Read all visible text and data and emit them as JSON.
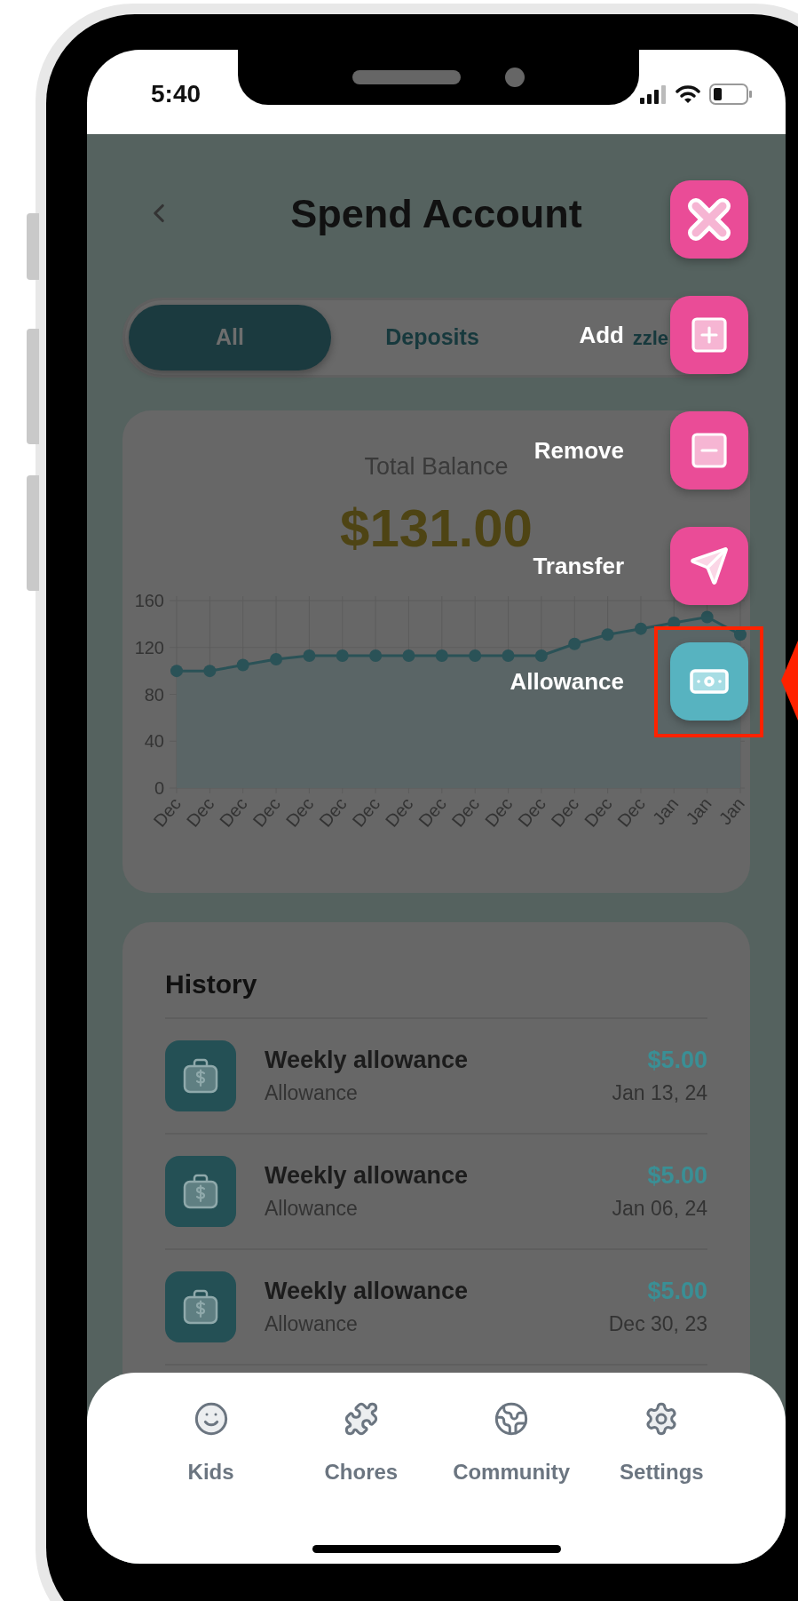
{
  "status_bar": {
    "time": "5:40"
  },
  "header": {
    "title": "Spend Account"
  },
  "tabs": [
    {
      "label": "All",
      "selected": true
    },
    {
      "label": "Deposits",
      "selected": false
    },
    {
      "label": "zzle",
      "selected": false
    }
  ],
  "balance": {
    "label": "Total Balance",
    "amount": "$131.00",
    "chart_data": {
      "type": "area",
      "categories": [
        "Dec",
        "Dec",
        "Dec",
        "Dec",
        "Dec",
        "Dec",
        "Dec",
        "Dec",
        "Dec",
        "Dec",
        "Dec",
        "Dec",
        "Dec",
        "Dec",
        "Dec",
        "Jan",
        "Jan",
        "Jan"
      ],
      "grid": true,
      "series": [
        {
          "color": "#2a5257",
          "values": [
            100,
            100,
            105,
            110,
            113,
            113,
            113,
            113,
            113,
            113,
            113,
            113,
            123,
            131,
            136,
            141,
            146,
            131
          ]
        }
      ],
      "ylim": [
        0,
        160
      ],
      "yticks": [
        0,
        40,
        80,
        120,
        160
      ]
    }
  },
  "history": {
    "title": "History",
    "items": [
      {
        "title": "Weekly allowance",
        "category": "Allowance",
        "amount": "$5.00",
        "date": "Jan 13, 24"
      },
      {
        "title": "Weekly allowance",
        "category": "Allowance",
        "amount": "$5.00",
        "date": "Jan 06, 24"
      },
      {
        "title": "Weekly allowance",
        "category": "Allowance",
        "amount": "$5.00",
        "date": "Dec 30, 23"
      }
    ]
  },
  "action_menu": [
    {
      "kind": "close",
      "highlighted": false
    },
    {
      "kind": "add",
      "label": "Add",
      "highlighted": false
    },
    {
      "kind": "remove",
      "label": "Remove",
      "highlighted": false
    },
    {
      "kind": "transfer",
      "label": "Transfer",
      "highlighted": false
    },
    {
      "kind": "allowance",
      "label": "Allowance",
      "highlighted": true
    }
  ],
  "nav": [
    {
      "kind": "kids",
      "label": "Kids"
    },
    {
      "kind": "chores",
      "label": "Chores"
    },
    {
      "kind": "community",
      "label": "Community"
    },
    {
      "kind": "settings",
      "label": "Settings"
    }
  ]
}
